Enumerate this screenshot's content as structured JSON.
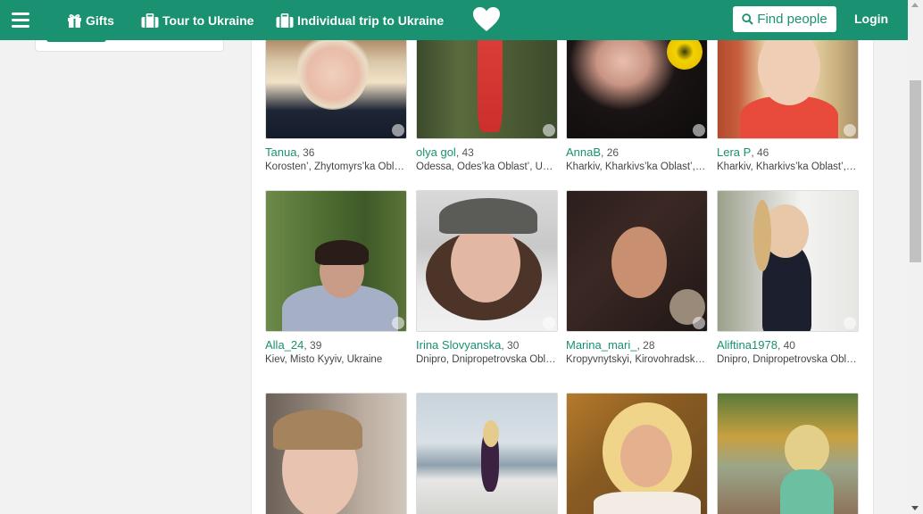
{
  "nav": {
    "gifts_label": "Gifts",
    "tour_label": "Tour to Ukraine",
    "trip_label": "Individual trip to Ukraine",
    "find_label": "Find people",
    "login_label": "Login"
  },
  "colors": {
    "brand": "#1a9170",
    "name_link": "#1a9170"
  },
  "icons": [
    "menu-icon",
    "gift-icon",
    "suitcase-icon",
    "heart-logo-icon",
    "search-icon"
  ],
  "profiles": [
    {
      "name": "Tanua",
      "age": ", 36",
      "location": "Korosten’, Zhytomyrs’ka Oblast’, Ukraine"
    },
    {
      "name": "olya gol",
      "age": ", 43",
      "location": "Odessa, Odes’ka Oblast’, Ukraine"
    },
    {
      "name": "AnnaB",
      "age": ", 26",
      "location": "Kharkiv, Kharkivs’ka Oblast’, Ukraine"
    },
    {
      "name": "Lera P",
      "age": ", 46",
      "location": "Kharkiv, Kharkivs’ka Oblast’, Ukraine"
    },
    {
      "name": "Alla_24",
      "age": ", 39",
      "location": "Kiev, Misto Kyyiv, Ukraine"
    },
    {
      "name": "Irina Slovyanska",
      "age": ", 30",
      "location": "Dnipro, Dnipropetrovska Oblast, Ukraine"
    },
    {
      "name": "Marina_mari_",
      "age": ", 28",
      "location": "Kropyvnytskyi, Kirovohradska Oblast, Ukraine"
    },
    {
      "name": "Aliftina1978",
      "age": ", 40",
      "location": "Dnipro, Dnipropetrovska Oblast, Ukraine"
    },
    {
      "name": "",
      "age": "",
      "location": ""
    },
    {
      "name": "",
      "age": "",
      "location": ""
    },
    {
      "name": "",
      "age": "",
      "location": ""
    },
    {
      "name": "",
      "age": "",
      "location": ""
    }
  ]
}
